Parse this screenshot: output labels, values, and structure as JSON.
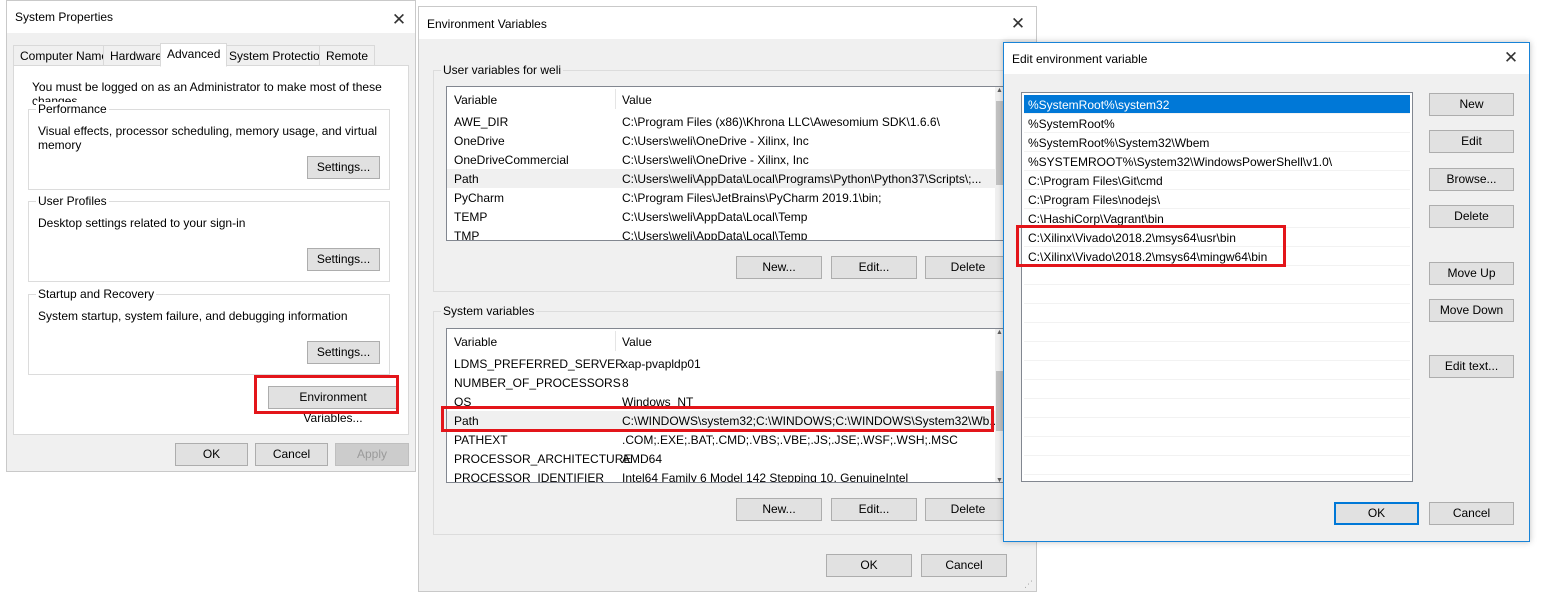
{
  "system_properties": {
    "title": "System Properties",
    "tabs": [
      "Computer Name",
      "Hardware",
      "Advanced",
      "System Protection",
      "Remote"
    ],
    "admin_note": "You must be logged on as an Administrator to make most of these changes.",
    "performance": {
      "label": "Performance",
      "desc": "Visual effects, processor scheduling, memory usage, and virtual memory",
      "button": "Settings..."
    },
    "user_profiles": {
      "label": "User Profiles",
      "desc": "Desktop settings related to your sign-in",
      "button": "Settings..."
    },
    "startup": {
      "label": "Startup and Recovery",
      "desc": "System startup, system failure, and debugging information",
      "button": "Settings..."
    },
    "env_button": "Environment Variables...",
    "ok": "OK",
    "cancel": "Cancel",
    "apply": "Apply"
  },
  "env_vars": {
    "title": "Environment Variables",
    "user_section": "User variables for weli",
    "col_variable": "Variable",
    "col_value": "Value",
    "user_rows": [
      {
        "name": "AWE_DIR",
        "value": "C:\\Program Files (x86)\\Khrona LLC\\Awesomium SDK\\1.6.6\\"
      },
      {
        "name": "OneDrive",
        "value": "C:\\Users\\weli\\OneDrive - Xilinx, Inc"
      },
      {
        "name": "OneDriveCommercial",
        "value": "C:\\Users\\weli\\OneDrive - Xilinx, Inc"
      },
      {
        "name": "Path",
        "value": "C:\\Users\\weli\\AppData\\Local\\Programs\\Python\\Python37\\Scripts\\;..."
      },
      {
        "name": "PyCharm",
        "value": "C:\\Program Files\\JetBrains\\PyCharm 2019.1\\bin;"
      },
      {
        "name": "TEMP",
        "value": "C:\\Users\\weli\\AppData\\Local\\Temp"
      },
      {
        "name": "TMP",
        "value": "C:\\Users\\weli\\AppData\\Local\\Temp"
      }
    ],
    "user_buttons": {
      "new": "New...",
      "edit": "Edit...",
      "delete": "Delete"
    },
    "system_section": "System variables",
    "system_rows": [
      {
        "name": "LDMS_PREFERRED_SERVER",
        "value": "xap-pvapldp01"
      },
      {
        "name": "NUMBER_OF_PROCESSORS",
        "value": "8"
      },
      {
        "name": "OS",
        "value": "Windows_NT"
      },
      {
        "name": "Path",
        "value": "C:\\WINDOWS\\system32;C:\\WINDOWS;C:\\WINDOWS\\System32\\Wb..."
      },
      {
        "name": "PATHEXT",
        "value": ".COM;.EXE;.BAT;.CMD;.VBS;.VBE;.JS;.JSE;.WSF;.WSH;.MSC"
      },
      {
        "name": "PROCESSOR_ARCHITECTURE",
        "value": "AMD64"
      },
      {
        "name": "PROCESSOR_IDENTIFIER",
        "value": "Intel64 Family 6 Model 142 Stepping 10, GenuineIntel"
      }
    ],
    "system_buttons": {
      "new": "New...",
      "edit": "Edit...",
      "delete": "Delete"
    },
    "ok": "OK",
    "cancel": "Cancel"
  },
  "edit_env": {
    "title": "Edit environment variable",
    "entries": [
      "%SystemRoot%\\system32",
      "%SystemRoot%",
      "%SystemRoot%\\System32\\Wbem",
      "%SYSTEMROOT%\\System32\\WindowsPowerShell\\v1.0\\",
      "C:\\Program Files\\Git\\cmd",
      "C:\\Program Files\\nodejs\\",
      "C:\\HashiCorp\\Vagrant\\bin",
      "C:\\Xilinx\\Vivado\\2018.2\\msys64\\usr\\bin",
      "C:\\Xilinx\\Vivado\\2018.2\\msys64\\mingw64\\bin"
    ],
    "buttons": {
      "new": "New",
      "edit": "Edit",
      "browse": "Browse...",
      "delete": "Delete",
      "move_up": "Move Up",
      "move_down": "Move Down",
      "edit_text": "Edit text..."
    },
    "ok": "OK",
    "cancel": "Cancel"
  },
  "colors": {
    "highlight": "#e3151a",
    "selection": "#0078d7",
    "dialog_bg": "#f0f0f0"
  }
}
